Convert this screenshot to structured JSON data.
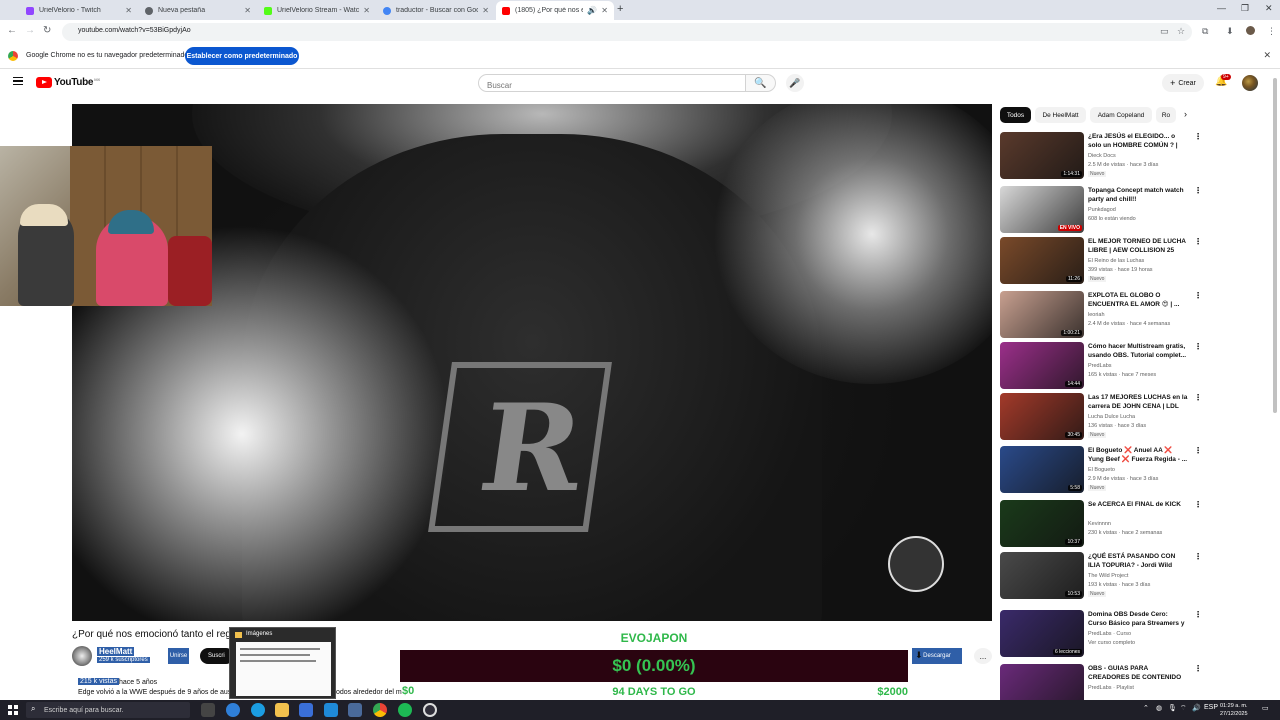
{
  "browser": {
    "tabs": [
      {
        "title": "UrielVelorio - Twitch",
        "color": "#9146ff"
      },
      {
        "title": "Nueva pestaña",
        "color": "#5f6368"
      },
      {
        "title": "UrielVelorio Stream - Watch Li...",
        "color": "#53fc18"
      },
      {
        "title": "traductor - Buscar con Google",
        "color": "#4285f4"
      },
      {
        "title": "(1805) ¿Por qué nos emoci...",
        "color": "#ff0000"
      }
    ],
    "url": "youtube.com/watch?v=53BiGpdyjAo",
    "infobar_message": "Google Chrome no es tu navegador predeterminado",
    "infobar_button": "Establecer como predeterminado"
  },
  "youtube": {
    "logo_text": "YouTube",
    "logo_country": "MX",
    "search_placeholder": "Buscar",
    "create_label": "Crear",
    "notifications_badge": "9+"
  },
  "video": {
    "title": "¿Por qué nos emocionó tanto el reg",
    "channel": "HeelMatt",
    "subscribers": "259 k suscriptores",
    "join_label": "Unirse",
    "subscribe_label": "Suscri",
    "views": "215 k vistas",
    "age": "hace 5 años",
    "description": "Edge volvió a la WWE después de 9 años de ause",
    "description_tail": "odos alrededor del m",
    "download_label": "Descargar",
    "more_label": "..."
  },
  "overlay": {
    "goal_title": "EVOJAPON",
    "amount": "$0 (0.00%)",
    "progress": 0.0,
    "min": "$0",
    "days": "94 DAYS TO GO",
    "max": "$2000",
    "popup_title": "Imágenes"
  },
  "sidebar": {
    "chips": [
      "Todos",
      "De HeelMatt",
      "Adam Copeland",
      "Ro"
    ],
    "recommendations": [
      {
        "title": "¿Era JESÚS el ELEGIDO... o solo un HOMBRE COMÚN ? | Jesús ...",
        "channel": "Dieck Docs",
        "meta": "2.5 M de vistas · hace 3 días",
        "badge": "Nuevo",
        "duration": "1:14:31",
        "color": "#5a3a2c"
      },
      {
        "title": "Topanga Concept match watch party and chill!!",
        "channel": "Punkdagod",
        "meta": "608 lo están viendo",
        "badge": "",
        "duration": "EN VIVO",
        "color": "#d8d8d8"
      },
      {
        "title": "EL MEJOR TORNEO DE LUCHA LIBRE | AEW COLLISION 25 de...",
        "channel": "El Reino de las Luchas",
        "meta": "399 vistas · hace 19 horas",
        "badge": "Nuevo",
        "duration": "11:26",
        "color": "#7a4a2a"
      },
      {
        "title": "EXPLOTA EL GLOBO O ENCUENTRA EL AMOR 😍 | ...",
        "channel": "leoriah",
        "meta": "2.4 M de vistas · hace 4 semanas",
        "badge": "",
        "duration": "1:00:21",
        "color": "#c8a090"
      },
      {
        "title": "Cómo hacer Multistream gratis, usando OBS. Tutorial complet...",
        "channel": "PredLabs",
        "meta": "165 k vistas · hace 7 meses",
        "badge": "",
        "duration": "14:44",
        "color": "#9b2f8a"
      },
      {
        "title": "Las 17 MEJORES LUCHAS en la carrera DE JOHN CENA | LDL",
        "channel": "Lucha Dulce Lucha",
        "meta": "136 vistas · hace 3 días",
        "badge": "Nuevo",
        "duration": "30:45",
        "color": "#a33a2a"
      },
      {
        "title": "El Bogueto ❌ Anuel AA ❌ Yung Beef ❌ Fuerza Regida - ...",
        "channel": "El Bogueto",
        "meta": "2.9 M de vistas · hace 3 días",
        "badge": "Nuevo",
        "duration": "5:58",
        "color": "#2a4a8a"
      },
      {
        "title": "Se ACERCA El FINAL de KICK",
        "channel": "Kevinnnn",
        "meta": "230 k vistas · hace 2 semanas",
        "badge": "",
        "duration": "10:37",
        "color": "#1a3a1a"
      },
      {
        "title": "¿QUÉ ESTÁ PASANDO CON ILIA TOPURIA? - Jordi Wild analiza ...",
        "channel": "The Wild Project",
        "meta": "193 k vistas · hace 3 días",
        "badge": "Nuevo",
        "duration": "10:53",
        "color": "#4a4a4a"
      },
      {
        "title": "Domina OBS Desde Cero: Curso Básico para Streamers y ...",
        "channel": "PredLabs · Curso",
        "meta": "Ver curso completo",
        "badge": "",
        "duration": "6 lecciones",
        "color": "#3a2a6a"
      },
      {
        "title": "OBS - GUIAS PARA CREADORES DE CONTENIDO",
        "channel": "PredLabs · Playlist",
        "meta": "",
        "badge": "",
        "duration": "",
        "color": "#6a2a7a"
      }
    ]
  },
  "taskbar": {
    "search_placeholder": "Escribe aquí para buscar.",
    "language": "ESP",
    "time": "01:29 a. m.",
    "date": "27/12/2025"
  }
}
